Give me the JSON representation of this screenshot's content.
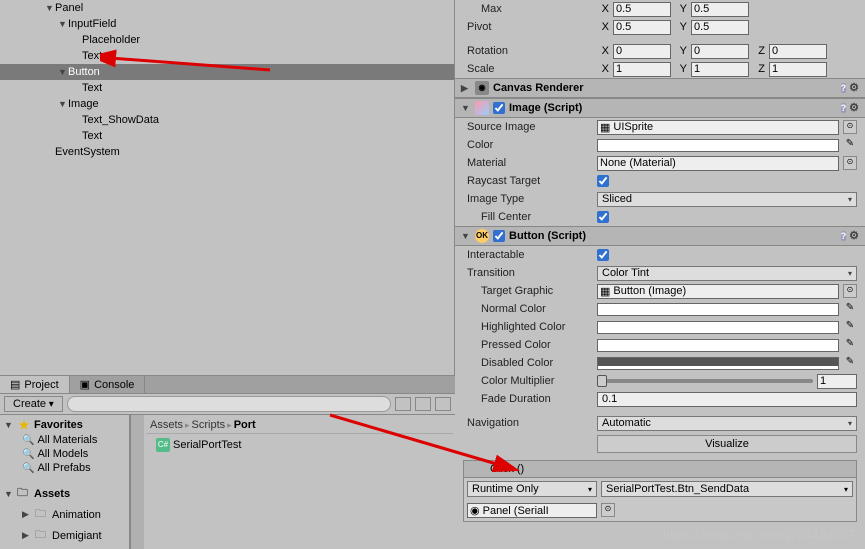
{
  "hierarchy": {
    "panel": "Panel",
    "inputfield": "InputField",
    "placeholder": "Placeholder",
    "text1": "Text",
    "button": "Button",
    "text2": "Text",
    "image": "Image",
    "text_showdata": "Text_ShowData",
    "text3": "Text",
    "eventsystem": "EventSystem"
  },
  "project": {
    "tab_project": "Project",
    "tab_console": "Console",
    "create": "Create",
    "favorites": "Favorites",
    "all_materials": "All Materials",
    "all_models": "All Models",
    "all_prefabs": "All Prefabs",
    "assets": "Assets",
    "animation": "Animation",
    "demigiant": "Demigiant",
    "breadcrumb": [
      "Assets",
      "Scripts",
      "Port"
    ],
    "file1": "SerialPortTest"
  },
  "transform": {
    "max": "Max",
    "pivot": "Pivot",
    "rotation": "Rotation",
    "scale": "Scale",
    "x": "X",
    "y": "Y",
    "z": "Z",
    "max_x": "0.5",
    "max_y": "0.5",
    "pivot_x": "0.5",
    "pivot_y": "0.5",
    "rot_x": "0",
    "rot_y": "0",
    "rot_z": "0",
    "scale_x": "1",
    "scale_y": "1",
    "scale_z": "1"
  },
  "canvas_renderer": "Canvas Renderer",
  "image_comp": {
    "title": "Image (Script)",
    "source_image": "Source Image",
    "source_val": "UISprite",
    "color": "Color",
    "material": "Material",
    "material_val": "None (Material)",
    "raycast": "Raycast Target",
    "image_type": "Image Type",
    "image_type_val": "Sliced",
    "fill_center": "Fill Center"
  },
  "button_comp": {
    "title": "Button (Script)",
    "interactable": "Interactable",
    "transition": "Transition",
    "transition_val": "Color Tint",
    "target_graphic": "Target Graphic",
    "target_val": "Button (Image)",
    "normal_color": "Normal Color",
    "highlighted_color": "Highlighted Color",
    "pressed_color": "Pressed Color",
    "disabled_color": "Disabled Color",
    "color_multiplier": "Color Multiplier",
    "mult_val": "1",
    "fade_duration": "Fade Duration",
    "fade_val": "0.1",
    "navigation": "Navigation",
    "nav_val": "Automatic",
    "visualize": "Visualize"
  },
  "onclick": {
    "header": "Click ()",
    "runtime": "Runtime Only",
    "method": "SerialPortTest.Btn_SendData",
    "target": "Panel (SerialI"
  },
  "watermark": "https://blog.csdn.net/q764424567"
}
